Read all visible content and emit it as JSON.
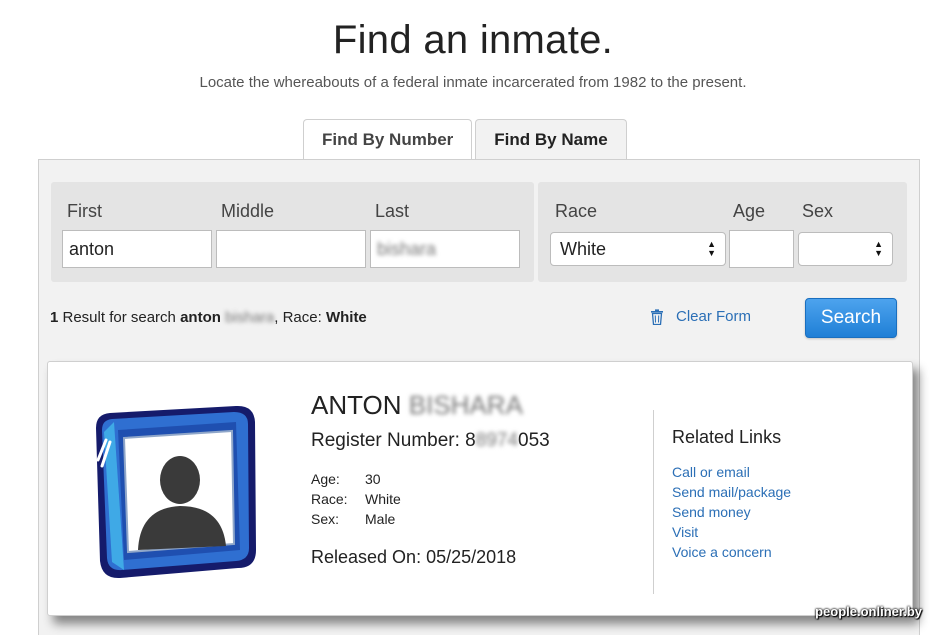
{
  "header": {
    "title": "Find an inmate.",
    "subtitle": "Locate the whereabouts of a federal inmate incarcerated from 1982 to the present."
  },
  "tabs": [
    {
      "label": "Find By Number",
      "active": false
    },
    {
      "label": "Find By Name",
      "active": true
    }
  ],
  "form": {
    "first": {
      "label": "First",
      "value": "anton"
    },
    "middle": {
      "label": "Middle",
      "value": ""
    },
    "last": {
      "label": "Last",
      "value": "bishara"
    },
    "race": {
      "label": "Race",
      "value": "White"
    },
    "age": {
      "label": "Age",
      "value": ""
    },
    "sex": {
      "label": "Sex",
      "value": ""
    }
  },
  "result": {
    "count": "1",
    "prefix": " Result for search ",
    "first": "anton",
    "last": "bishara",
    "race_label": ", Race: ",
    "race": "White"
  },
  "actions": {
    "clear_label": "Clear Form",
    "search_label": "Search"
  },
  "inmate": {
    "first_name": "ANTON",
    "last_name": "BISHARA",
    "register_label": "Register Number: ",
    "register_prefix": "8",
    "register_hidden": "8974",
    "register_suffix": "053",
    "age_label": "Age:",
    "age": "30",
    "race_label": "Race:",
    "race": "White",
    "sex_label": "Sex:",
    "sex": "Male",
    "released_label": "Released On: ",
    "released": "05/25/2018"
  },
  "related": {
    "title": "Related Links",
    "links": [
      "Call or email",
      "Send mail/package",
      "Send money",
      "Visit",
      "Voice a concern"
    ]
  },
  "watermark": "people.onliner.by",
  "colors": {
    "link": "#2b6fb6",
    "button": "#1f7fd6",
    "panel": "#f2f2f2"
  }
}
